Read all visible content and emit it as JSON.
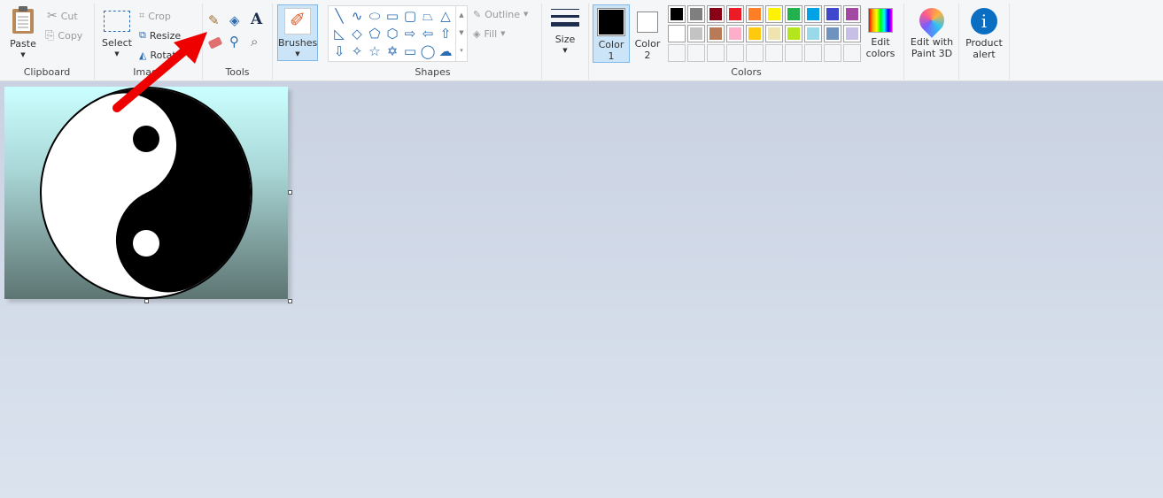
{
  "clipboard": {
    "paste": "Paste",
    "cut": "Cut",
    "copy": "Copy",
    "label": "Clipboard"
  },
  "image": {
    "select": "Select",
    "crop": "Crop",
    "resize": "Resize",
    "rotate": "Rotate",
    "label": "Image"
  },
  "tools": {
    "label": "Tools",
    "items": [
      "pencil-icon",
      "fill-icon",
      "text-icon",
      "eraser-icon",
      "color-picker-icon",
      "magnifier-icon"
    ]
  },
  "brushes": {
    "label": "Brushes"
  },
  "shapes": {
    "label": "Shapes",
    "outline": "Outline",
    "fill": "Fill",
    "items": [
      "╲",
      "∿",
      "⬭",
      "▭",
      "▢",
      "⏢",
      "△",
      "◺",
      "◇",
      "⬠",
      "⬡",
      "⇨",
      "⇦",
      "⇧",
      "⇩",
      "✧",
      "☆",
      "✡",
      "▭",
      "◯",
      "☁"
    ]
  },
  "size": {
    "label": "Size"
  },
  "colors": {
    "label": "Colors",
    "color1": "Color 1",
    "color1_line1": "Color",
    "color1_line2": "1",
    "color2_line1": "Color",
    "color2_line2": "2",
    "color1_value": "#000000",
    "color2_value": "#ffffff",
    "palette": [
      "#000000",
      "#7f7f7f",
      "#880015",
      "#ed1c24",
      "#ff7f27",
      "#fff200",
      "#22b14c",
      "#00a2e8",
      "#3f48cc",
      "#a349a4",
      "#ffffff",
      "#c3c3c3",
      "#b97a57",
      "#ffaec9",
      "#ffc90e",
      "#efe4b0",
      "#b5e61d",
      "#99d9ea",
      "#7092be",
      "#c8bfe7"
    ],
    "edit_line1": "Edit",
    "edit_line2": "colors"
  },
  "paint3d": {
    "line1": "Edit with",
    "line2": "Paint 3D"
  },
  "product_alert": {
    "line1": "Product",
    "line2": "alert"
  },
  "annotation": {
    "arrow_color": "#ff0000"
  }
}
